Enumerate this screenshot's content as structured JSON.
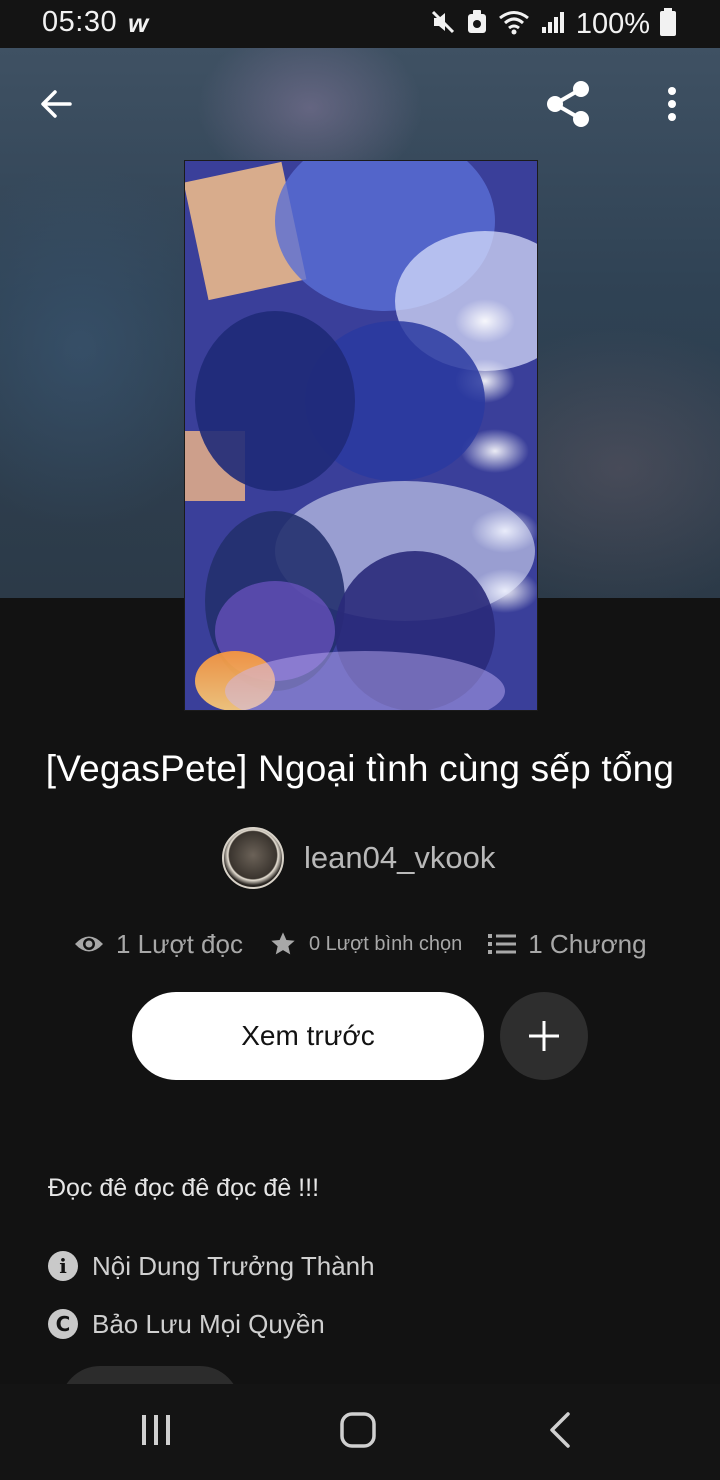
{
  "status_bar": {
    "time": "05:30",
    "app_glyph": "w",
    "battery": "100%",
    "icons": [
      "mute-icon",
      "data-saver-icon",
      "wifi-icon",
      "signal-icon",
      "battery-icon"
    ]
  },
  "toolbar": {
    "back_icon": "arrow-left-icon",
    "share_icon": "share-icon",
    "more_icon": "more-vertical-icon"
  },
  "story": {
    "title": "[VegasPete] Ngoại tình cùng sếp tổng",
    "author": "lean04_vkook",
    "stats": {
      "reads": "1 Lượt đọc",
      "votes": "0 Lượt bình chọn",
      "chapters": "1 Chương"
    },
    "preview_label": "Xem trước",
    "description": "Đọc đê đọc đê đọc đê !!!",
    "content_rating": "Nội Dung Trưởng Thành",
    "copyright": "Bảo Lưu Mọi Quyền"
  },
  "colors": {
    "background": "#121212",
    "primary_button": "#ffffff",
    "secondary_button": "#2e2e2e",
    "muted_text": "#a8a8a8"
  },
  "navigation": {
    "icons": [
      "recent-apps-icon",
      "home-icon",
      "back-icon"
    ]
  }
}
